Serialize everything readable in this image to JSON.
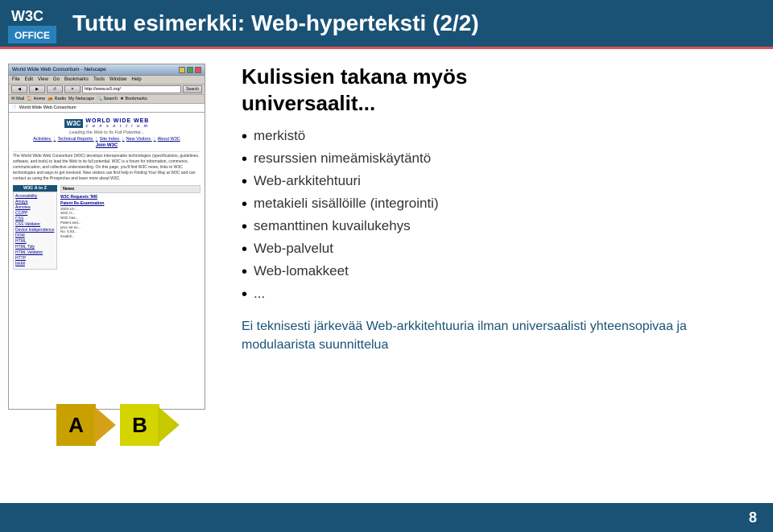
{
  "header": {
    "title": "Tuttu esimerkki: Web-hyperteksti (2/2)",
    "logo_text": "W3C",
    "logo_sub": "OFFICE"
  },
  "browser": {
    "titlebar": "World Wide Web Consortium - Netscape",
    "menu_items": [
      "File",
      "Edit",
      "View",
      "Go",
      "Bookmarks",
      "Tools",
      "Window",
      "Help"
    ],
    "url": "http://www.w3.org/",
    "search_label": "Search",
    "nav_icons": [
      "Mail",
      "Home",
      "Radio",
      "My Netscape",
      "Search",
      "Bookmarks"
    ],
    "location_label": "World Wide Web Consortium",
    "w3c_world": "WORLD WIDE WEB",
    "w3c_consortium": "c o n s o r t i u m",
    "tagline": "Leading the Web to Its Full Potential...",
    "nav_links": [
      "Activities",
      "Technical Reports",
      "Site Index",
      "New Visitors",
      "About W3C"
    ],
    "join": "Join W3C",
    "description": "The World Wide Web Consortium (W3C) develops interoperable technologies (specifications, guidelines, software, and tools) to lead the Web to its full potential. W3C is a forum for information, commerce, communication, and collective understanding. On this page, you'll find W3C news, links to W3C technologies and ways to get involved. New visitors can find help in Finding Your Way at W3C and can contact us using the Prospectus and learn more about W3C.",
    "sidebar_title": "W3C A to Z",
    "sidebar_links": [
      "Accessibility",
      "Amaya",
      "Annotea",
      "CC/PP",
      "CSS",
      "CSS Validator",
      "Device Independence",
      "DOM",
      "HTML",
      "HTML Tidy",
      "HTML Validator",
      "HTTP",
      "InkMl"
    ],
    "news_title": "News",
    "news_item1": "W3C Requests '906",
    "news_item2": "Patent Re-Examination",
    "news_date": "2003-10-...",
    "news_text1": "W3C H...",
    "news_text2": "W3C has...",
    "news_text3": "Patent and...",
    "news_text4": "prior art es...",
    "news_text5": "No. 5,83...",
    "news_text6": "invalidi..."
  },
  "arrows": {
    "label_a": "A",
    "label_b": "B"
  },
  "content": {
    "heading_line1": "Kulissien takana myös",
    "heading_line2": "universaalit...",
    "bullets": [
      "merkistö",
      "resurssien nimeämiskäytäntö",
      "Web-arkkitehtuuri",
      "metakieli sisällöille (integrointi)",
      "semanttinen kuvailukehys",
      "Web-palvelut",
      "Web-lomakkeet",
      "..."
    ],
    "bottom_text": "Ei teknisesti järkevää Web-arkkitehtuuria ilman universaalisti yhteensopivaa ja modulaarista suunnittelua"
  },
  "footer": {
    "page_number": "8"
  }
}
